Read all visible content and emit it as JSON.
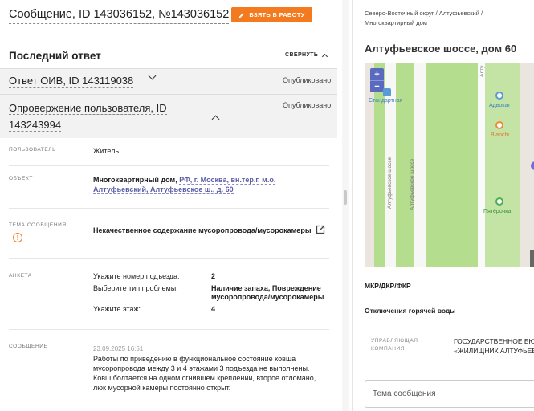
{
  "header": {
    "message_title": "Сообщение, ID 143036152, №143036152",
    "take_to_work_label": "ВЗЯТЬ В РАБОТУ"
  },
  "last_answer": {
    "title": "Последний ответ",
    "collapse_label": "СВЕРНУТЬ"
  },
  "answers": [
    {
      "title": "Ответ ОИВ, ID 143119038",
      "status": "Опубликовано"
    },
    {
      "title": "Опровержение пользователя, ID 143243994",
      "status": "Опубликовано"
    }
  ],
  "details": {
    "user": {
      "label": "ПОЛЬЗОВАТЕЛЬ",
      "value": "Житель"
    },
    "object": {
      "label": "ОБЪЕКТ",
      "prefix": "Многоквартирный дом,",
      "link": "РФ, г. Москва, вн.тер.г. м.о. Алтуфьевский, Алтуфьевское ш., д. 60"
    },
    "topic": {
      "label": "ТЕМА СООБЩЕНИЯ",
      "value": "Некачественное содержание мусоропровода/мусорокамеры"
    },
    "form": {
      "label": "АНКЕТА",
      "items": [
        {
          "q": "Укажите номер подъезда:",
          "a": "2"
        },
        {
          "q": "Выберите тип проблемы:",
          "a": "Наличие запаха, Повреждение мусоропровода/мусорокамеры"
        },
        {
          "q": "Укажите этаж:",
          "a": "4"
        }
      ]
    },
    "message": {
      "label": "СООБЩЕНИЕ",
      "date": "23.09.2025 16:51",
      "text": "Работы по приведению в функциональное состояние ковша мусоропровода между 3 и 4 этажами 3 подъезда не выполнены. Ковш болтается на одном сгнившем креплении, второе отломано, люк мусорной камеры постоянно открыт."
    }
  },
  "right_panel": {
    "breadcrumb": "Северо-Восточный округ / Алтуфьевский / Многоквартирный дом",
    "address": "Алтуфьевское шоссе, дом 60",
    "map": {
      "zoom_in": "+",
      "zoom_out": "−",
      "road_label_1": "Алтуфьевское шоссе",
      "road_label_2": "Алтуфьевское шоссе",
      "road_label_3": "Алту",
      "poi_standard": "Стандартная",
      "poi_advokat": "Адвокат",
      "poi_bianchi": "Bianchi",
      "poi_pyaterochka": "Пятёрочка"
    },
    "section1": "МКР/ДКР/ФКР",
    "section2": "Отключения горячей воды",
    "management_label": "УПРАВЛЯЮЩАЯ КОМПАНИЯ",
    "management_value_line1": "ГОСУДАРСТВЕННОЕ БЮД",
    "management_value_line2": "«ЖИЛИЩНИК АЛТУФЬЕВ",
    "topic_placeholder": "Тема сообщения"
  }
}
